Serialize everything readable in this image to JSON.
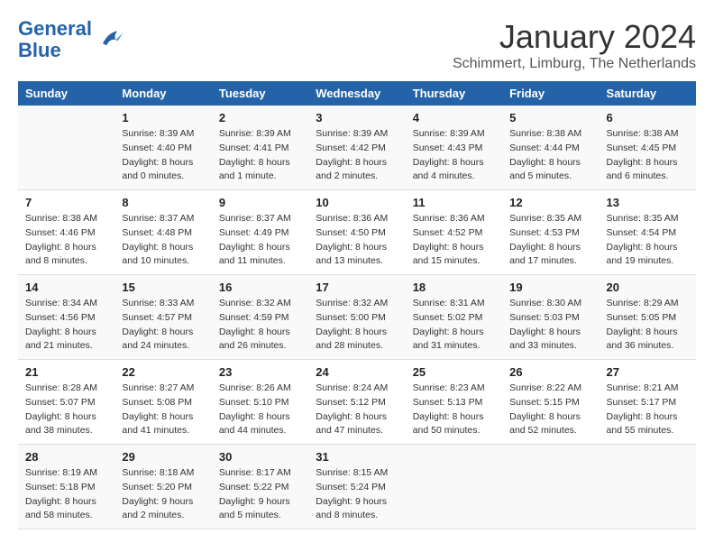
{
  "logo": {
    "line1": "General",
    "line2": "Blue"
  },
  "title": "January 2024",
  "subtitle": "Schimmert, Limburg, The Netherlands",
  "weekdays": [
    "Sunday",
    "Monday",
    "Tuesday",
    "Wednesday",
    "Thursday",
    "Friday",
    "Saturday"
  ],
  "weeks": [
    [
      {
        "day": "",
        "info": ""
      },
      {
        "day": "1",
        "info": "Sunrise: 8:39 AM\nSunset: 4:40 PM\nDaylight: 8 hours\nand 0 minutes."
      },
      {
        "day": "2",
        "info": "Sunrise: 8:39 AM\nSunset: 4:41 PM\nDaylight: 8 hours\nand 1 minute."
      },
      {
        "day": "3",
        "info": "Sunrise: 8:39 AM\nSunset: 4:42 PM\nDaylight: 8 hours\nand 2 minutes."
      },
      {
        "day": "4",
        "info": "Sunrise: 8:39 AM\nSunset: 4:43 PM\nDaylight: 8 hours\nand 4 minutes."
      },
      {
        "day": "5",
        "info": "Sunrise: 8:38 AM\nSunset: 4:44 PM\nDaylight: 8 hours\nand 5 minutes."
      },
      {
        "day": "6",
        "info": "Sunrise: 8:38 AM\nSunset: 4:45 PM\nDaylight: 8 hours\nand 6 minutes."
      }
    ],
    [
      {
        "day": "7",
        "info": "Sunrise: 8:38 AM\nSunset: 4:46 PM\nDaylight: 8 hours\nand 8 minutes."
      },
      {
        "day": "8",
        "info": "Sunrise: 8:37 AM\nSunset: 4:48 PM\nDaylight: 8 hours\nand 10 minutes."
      },
      {
        "day": "9",
        "info": "Sunrise: 8:37 AM\nSunset: 4:49 PM\nDaylight: 8 hours\nand 11 minutes."
      },
      {
        "day": "10",
        "info": "Sunrise: 8:36 AM\nSunset: 4:50 PM\nDaylight: 8 hours\nand 13 minutes."
      },
      {
        "day": "11",
        "info": "Sunrise: 8:36 AM\nSunset: 4:52 PM\nDaylight: 8 hours\nand 15 minutes."
      },
      {
        "day": "12",
        "info": "Sunrise: 8:35 AM\nSunset: 4:53 PM\nDaylight: 8 hours\nand 17 minutes."
      },
      {
        "day": "13",
        "info": "Sunrise: 8:35 AM\nSunset: 4:54 PM\nDaylight: 8 hours\nand 19 minutes."
      }
    ],
    [
      {
        "day": "14",
        "info": "Sunrise: 8:34 AM\nSunset: 4:56 PM\nDaylight: 8 hours\nand 21 minutes."
      },
      {
        "day": "15",
        "info": "Sunrise: 8:33 AM\nSunset: 4:57 PM\nDaylight: 8 hours\nand 24 minutes."
      },
      {
        "day": "16",
        "info": "Sunrise: 8:32 AM\nSunset: 4:59 PM\nDaylight: 8 hours\nand 26 minutes."
      },
      {
        "day": "17",
        "info": "Sunrise: 8:32 AM\nSunset: 5:00 PM\nDaylight: 8 hours\nand 28 minutes."
      },
      {
        "day": "18",
        "info": "Sunrise: 8:31 AM\nSunset: 5:02 PM\nDaylight: 8 hours\nand 31 minutes."
      },
      {
        "day": "19",
        "info": "Sunrise: 8:30 AM\nSunset: 5:03 PM\nDaylight: 8 hours\nand 33 minutes."
      },
      {
        "day": "20",
        "info": "Sunrise: 8:29 AM\nSunset: 5:05 PM\nDaylight: 8 hours\nand 36 minutes."
      }
    ],
    [
      {
        "day": "21",
        "info": "Sunrise: 8:28 AM\nSunset: 5:07 PM\nDaylight: 8 hours\nand 38 minutes."
      },
      {
        "day": "22",
        "info": "Sunrise: 8:27 AM\nSunset: 5:08 PM\nDaylight: 8 hours\nand 41 minutes."
      },
      {
        "day": "23",
        "info": "Sunrise: 8:26 AM\nSunset: 5:10 PM\nDaylight: 8 hours\nand 44 minutes."
      },
      {
        "day": "24",
        "info": "Sunrise: 8:24 AM\nSunset: 5:12 PM\nDaylight: 8 hours\nand 47 minutes."
      },
      {
        "day": "25",
        "info": "Sunrise: 8:23 AM\nSunset: 5:13 PM\nDaylight: 8 hours\nand 50 minutes."
      },
      {
        "day": "26",
        "info": "Sunrise: 8:22 AM\nSunset: 5:15 PM\nDaylight: 8 hours\nand 52 minutes."
      },
      {
        "day": "27",
        "info": "Sunrise: 8:21 AM\nSunset: 5:17 PM\nDaylight: 8 hours\nand 55 minutes."
      }
    ],
    [
      {
        "day": "28",
        "info": "Sunrise: 8:19 AM\nSunset: 5:18 PM\nDaylight: 8 hours\nand 58 minutes."
      },
      {
        "day": "29",
        "info": "Sunrise: 8:18 AM\nSunset: 5:20 PM\nDaylight: 9 hours\nand 2 minutes."
      },
      {
        "day": "30",
        "info": "Sunrise: 8:17 AM\nSunset: 5:22 PM\nDaylight: 9 hours\nand 5 minutes."
      },
      {
        "day": "31",
        "info": "Sunrise: 8:15 AM\nSunset: 5:24 PM\nDaylight: 9 hours\nand 8 minutes."
      },
      {
        "day": "",
        "info": ""
      },
      {
        "day": "",
        "info": ""
      },
      {
        "day": "",
        "info": ""
      }
    ]
  ]
}
